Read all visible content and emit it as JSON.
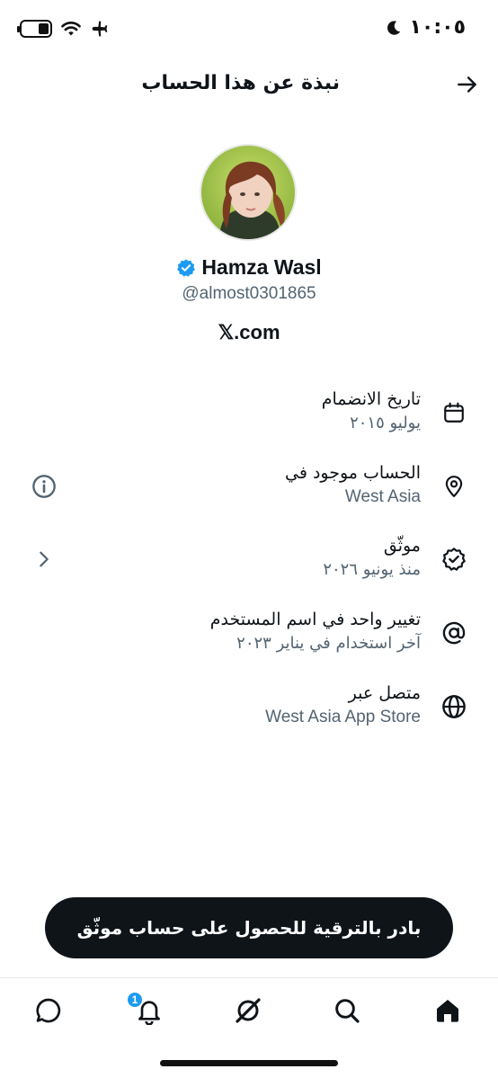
{
  "status_bar": {
    "time": "١٠:٠٥",
    "icons": [
      "battery-icon",
      "wifi-icon",
      "airplane-icon",
      "moon-icon"
    ]
  },
  "header": {
    "title": "نبذة عن هذا الحساب",
    "back_icon": "arrow-right-icon"
  },
  "profile": {
    "display_name": "Hamza Wasl",
    "handle": "@almost0301865",
    "site": "𝕏.com",
    "verified_color": "#1d9bf0"
  },
  "rows": [
    {
      "icon": "calendar-icon",
      "label": "تاريخ الانضمام",
      "value": "يوليو ٢٠١٥"
    },
    {
      "icon": "location-pin-icon",
      "label": "الحساب موجود في",
      "value": "West Asia",
      "aux_icon": "info-icon"
    },
    {
      "icon": "verified-badge-icon",
      "label": "موثّق",
      "value": "منذ يونيو ٢٠٢٦",
      "aux_icon": "chevron-right-icon"
    },
    {
      "icon": "at-sign-icon",
      "label": "تغيير واحد في اسم المستخدم",
      "value": "آخر استخدام في يناير ٢٠٢٣"
    },
    {
      "icon": "globe-icon",
      "label": "متصل عبر",
      "value": "West Asia App Store"
    }
  ],
  "upgrade_button": {
    "label": "بادر بالترقية للحصول على حساب موثّق"
  },
  "bottom_nav": {
    "items": [
      "messages-icon",
      "notifications-icon",
      "grok-icon",
      "search-icon",
      "home-icon"
    ],
    "notification_count": "1",
    "accent": "#1d9bf0"
  }
}
